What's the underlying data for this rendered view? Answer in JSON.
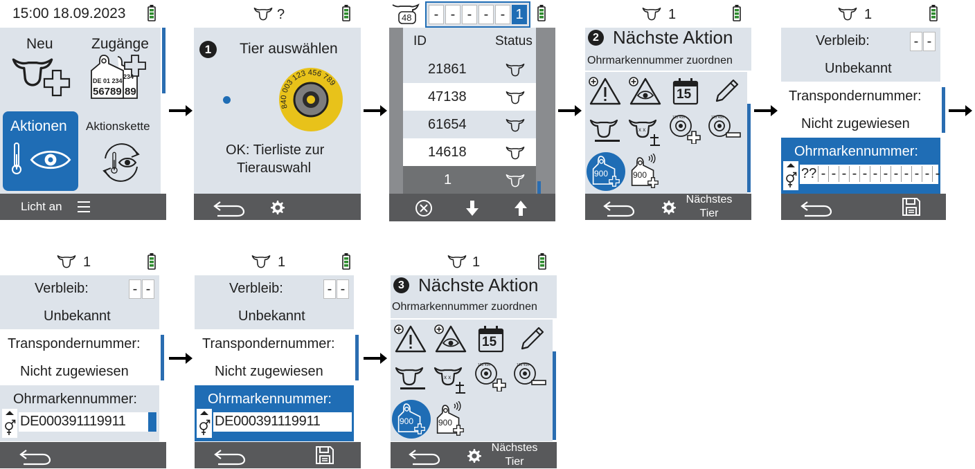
{
  "screen1": {
    "time": "15:00 18.09.2023",
    "tile_neu": "Neu",
    "tile_zugaenge": "Zugänge",
    "tag_line1": "DE 01 234",
    "tag_line2": "56789",
    "tag_peek": "234",
    "tag_peek2": "89",
    "tile_aktionen": "Aktionen",
    "tile_aktionskette": "Aktionskette",
    "footer_label": "Licht an"
  },
  "screen2": {
    "header": "?",
    "step": "1",
    "title": "Tier auswählen",
    "hint_line1": "OK: Tierliste zur",
    "hint_line2": "Tierauswahl",
    "tag_ring_text": "840 003 123 456 789"
  },
  "screen3": {
    "animal_count": "48",
    "digits": [
      "-",
      "-",
      "-",
      "-",
      "-",
      "1"
    ],
    "col_id": "ID",
    "col_status": "Status",
    "rows": [
      "21861",
      "47138",
      "61654",
      "14618",
      "1"
    ]
  },
  "screen4": {
    "header": "1",
    "step": "2",
    "title": "Nächste Aktion",
    "subtitle": "Ohrmarkennummer zuordnen",
    "tag_num": "900",
    "footer_next_l1": "Nächstes",
    "footer_next_l2": "Tier",
    "calendar_day": "15"
  },
  "screen5": {
    "header": "1",
    "verbleib_label": "Verbleib:",
    "verbleib_value": "Unbekannt",
    "verbleib_boxes": [
      "-",
      "-"
    ],
    "transponder_label": "Transpondernummer:",
    "transponder_value": "Nicht zugewiesen",
    "ohrmarke_label": "Ohrmarkennummer:",
    "ohrmarke_prefix": "??",
    "ohrmarke_digits": [
      "-",
      "-",
      "-",
      "-",
      "-",
      "-",
      "-",
      "-",
      "-",
      "-",
      "-",
      "-"
    ]
  },
  "screen6": {
    "header": "1",
    "verbleib_label": "Verbleib:",
    "verbleib_value": "Unbekannt",
    "verbleib_boxes": [
      "-",
      "-"
    ],
    "transponder_label": "Transpondernummer:",
    "transponder_value": "Nicht zugewiesen",
    "ohrmarke_label": "Ohrmarkennummer:",
    "ohrmarke_value": "DE000391119911"
  },
  "screen7": {
    "header": "1",
    "verbleib_label": "Verbleib:",
    "verbleib_value": "Unbekannt",
    "verbleib_boxes": [
      "-",
      "-"
    ],
    "transponder_label": "Transpondernummer:",
    "transponder_value": "Nicht zugewiesen",
    "ohrmarke_label": "Ohrmarkennummer:",
    "ohrmarke_value": "DE000391119911"
  },
  "screen8": {
    "header": "1",
    "step": "3",
    "title": "Nächste Aktion",
    "subtitle": "Ohrmarkennummer zuordnen",
    "tag_num": "900",
    "footer_next_l1": "Nächstes",
    "footer_next_l2": "Tier",
    "calendar_day": "15"
  },
  "colors": {
    "accent": "#1f6db5",
    "panel": "#dde3ea",
    "footer": "#58595b",
    "battery": "#2e8b2e",
    "tag_yellow": "#e8c21a"
  }
}
